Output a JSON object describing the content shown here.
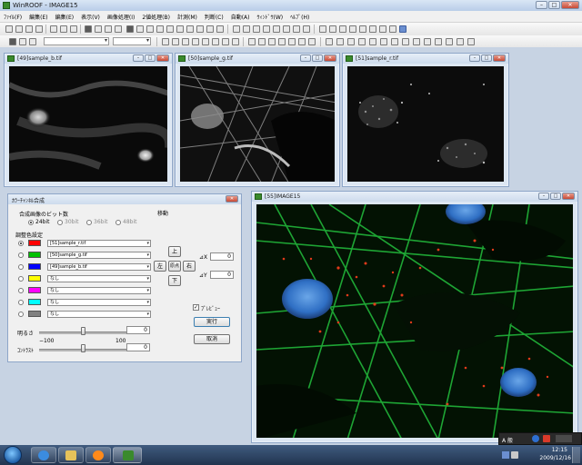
{
  "main_window": {
    "title": "WinROOF - IMAGE15"
  },
  "menu": [
    "ﾌｧｲﾙ(F)",
    "編集(E)",
    "編集(E)",
    "表示(V)",
    "画像処理(I)",
    "2値処理(B)",
    "計測(M)",
    "判断(C)",
    "自動(A)",
    "ｳｨﾝﾄﾞｳ(W)",
    "ﾍﾙﾌﾟ(H)"
  ],
  "windows": [
    {
      "title": "[49]sample_b.tif"
    },
    {
      "title": "[50]sample_g.tif"
    },
    {
      "title": "[51]sample_r.tif"
    },
    {
      "title": "[55]IMAGE15"
    }
  ],
  "dialog": {
    "title": "ｶﾗｰﾁｬﾝﾈﾙ合成",
    "bit_group_label": "合成画像のビット数",
    "bit_options": [
      "24bit",
      "30bit",
      "36bit",
      "48bit"
    ],
    "bit_selected": "24bit",
    "channel_group_label": "調整色設定",
    "channels": [
      {
        "color": "#ff0000",
        "source": "[51]sample_r.tif"
      },
      {
        "color": "#00c000",
        "source": "[50]sample_g.tif"
      },
      {
        "color": "#0000ff",
        "source": "[49]sample_b.tif"
      },
      {
        "color": "#ffff00",
        "source": "なし"
      },
      {
        "color": "#ff00ff",
        "source": "なし"
      },
      {
        "color": "#00ffff",
        "source": "なし"
      },
      {
        "color": "#808080",
        "source": "なし"
      }
    ],
    "move_label": "移動",
    "up_label": "上",
    "left_label": "左",
    "origin_label": "原点",
    "right_label": "右",
    "down_label": "下",
    "dx_label": "⊿X",
    "dx_value": "0",
    "dy_label": "⊿Y",
    "dy_value": "0",
    "preview_label": "ﾌﾟﾚﾋﾞｭｰ",
    "preview_checked": true,
    "execute_label": "実行",
    "cancel_label": "取消",
    "brightness_label": "明るさ",
    "brightness_value": "0",
    "brightness_min": "−100",
    "brightness_max": "100",
    "contrast_label": "ｺﾝﾄﾗｽﾄ",
    "contrast_value": "0"
  },
  "taskbar": {
    "time": "12:15",
    "date": "2009/12/16"
  },
  "ime": {
    "mode_label": "A 般"
  }
}
